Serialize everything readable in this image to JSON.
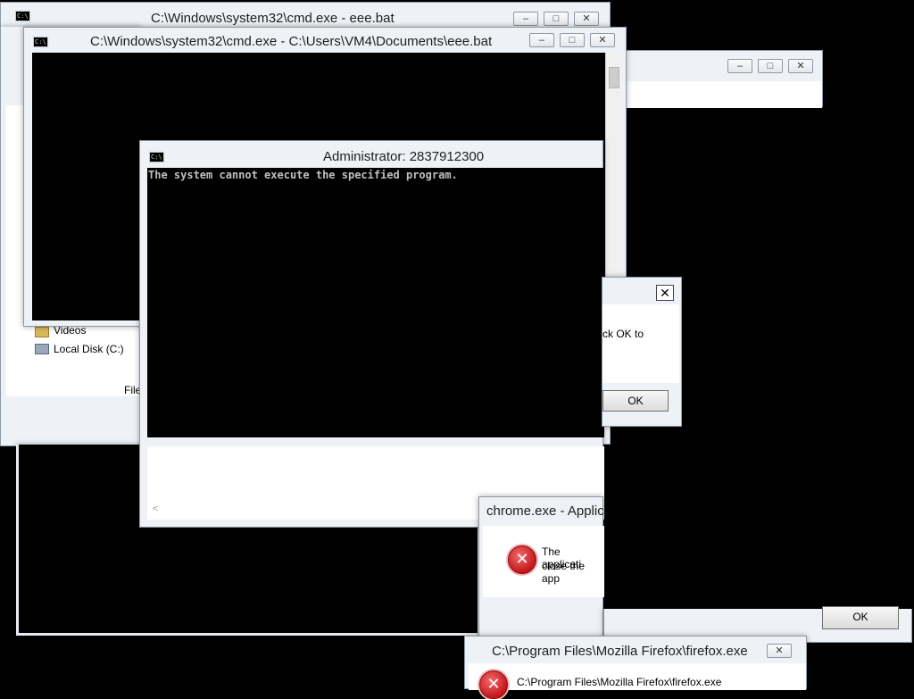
{
  "windows": {
    "cmd_back": {
      "title": "C:\\Windows\\system32\\cmd.exe - eee.bat",
      "controls": [
        "–",
        "□",
        "✕"
      ]
    },
    "cmd_front": {
      "title": "C:\\Windows\\system32\\cmd.exe - C:\\Users\\VM4\\Documents\\eee.bat",
      "controls": [
        "–",
        "□",
        "✕"
      ]
    },
    "explorer": {
      "controls": [
        "–",
        "□",
        "✕"
      ],
      "tree": [
        "Videos",
        "Local Disk (C:)"
      ],
      "partial_label": "File"
    },
    "admin": {
      "title": "Administrator:  2837912300",
      "console_text": "The system cannot execute the specified program.",
      "scroll_left": "<"
    },
    "dialog_small": {
      "close": "✕",
      "text_fragment": "ck OK to",
      "ok": "OK"
    },
    "chrome_error": {
      "title": "chrome.exe - Applic",
      "line1": "The applicati",
      "line2": "close the app",
      "ok": "OK"
    },
    "firefox_error": {
      "title": "C:\\Program Files\\Mozilla Firefox\\firefox.exe",
      "message": "C:\\Program Files\\Mozilla Firefox\\firefox.exe",
      "close": "✕"
    }
  },
  "icons": {
    "console": "console-window-icon",
    "error": "error-x-icon",
    "folder": "folder-icon",
    "drive": "disk-drive-icon"
  },
  "colors": {
    "desktop": "#000000",
    "chrome_frame": "#eef1f5",
    "console_bg": "#000000",
    "console_text": "#c0c0c0",
    "error_red": "#c4161c"
  }
}
